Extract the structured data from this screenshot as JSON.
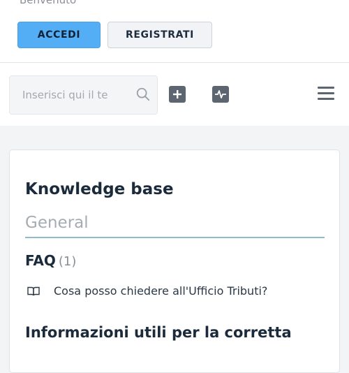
{
  "header": {
    "welcome": "Benvenuto",
    "login_label": "ACCEDI",
    "register_label": "REGISTRATI"
  },
  "toolbar": {
    "search_placeholder": "Inserisci qui il te",
    "icons": [
      "search-icon",
      "add-icon",
      "activity-icon",
      "menu-icon"
    ]
  },
  "knowledge_base": {
    "title": "Knowledge base",
    "subtitle": "General",
    "faq": {
      "title": "FAQ",
      "count": "(1)",
      "items": [
        {
          "label": "Cosa posso chiedere all'Ufficio Tributi?",
          "icon": "book-icon"
        }
      ]
    },
    "next_section_title": "Informazioni utili per la corretta"
  },
  "colors": {
    "primary_button": "#53aef6",
    "icon_dark": "#5d6570",
    "underline": "#8fbcc8"
  }
}
